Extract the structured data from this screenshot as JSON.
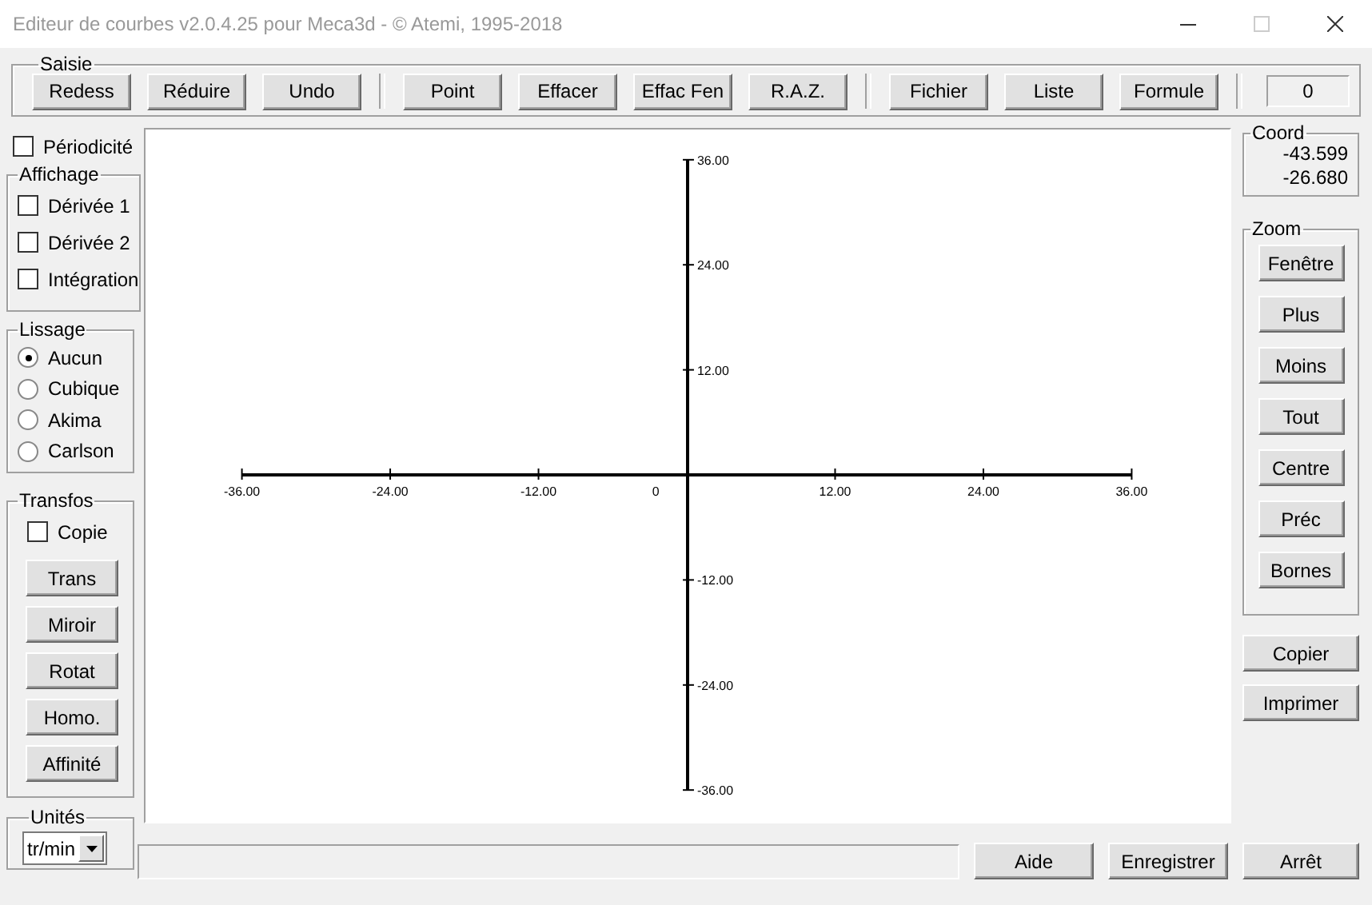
{
  "window": {
    "title": "Editeur de courbes v2.0.4.25 pour Meca3d - © Atemi, 1995-2018",
    "controls": [
      {
        "kind": "minimize",
        "disabled": false
      },
      {
        "kind": "maximize",
        "disabled": true
      },
      {
        "kind": "close",
        "disabled": false
      }
    ]
  },
  "saisie": {
    "label": "Saisie",
    "groups": [
      [
        "Redess",
        "Réduire",
        "Undo"
      ],
      [
        "Point",
        "Effacer",
        "Effac Fen",
        "R.A.Z."
      ],
      [
        "Fichier",
        "Liste",
        "Formule"
      ]
    ],
    "counter": "0"
  },
  "periodicite": {
    "label": "Périodicité",
    "checked": false
  },
  "affichage": {
    "label": "Affichage",
    "options": [
      {
        "label": "Dérivée 1",
        "checked": false
      },
      {
        "label": "Dérivée 2",
        "checked": false
      },
      {
        "label": "Intégration",
        "checked": false
      }
    ]
  },
  "lissage": {
    "label": "Lissage",
    "options": [
      {
        "label": "Aucun",
        "selected": true
      },
      {
        "label": "Cubique",
        "selected": false
      },
      {
        "label": "Akima",
        "selected": false
      },
      {
        "label": "Carlson",
        "selected": false
      }
    ]
  },
  "transfos": {
    "label": "Transfos",
    "copy": {
      "label": "Copie",
      "checked": false
    },
    "buttons": [
      "Trans",
      "Miroir",
      "Rotat",
      "Homo.",
      "Affinité"
    ]
  },
  "unites": {
    "label": "Unités",
    "value": "tr/min"
  },
  "plot": {
    "x_labels": [
      "-36.00",
      "-24.00",
      "-12.00",
      "0",
      "12.00",
      "24.00",
      "36.00"
    ],
    "y_labels": [
      "36.00",
      "24.00",
      "12.00",
      "-12.00",
      "-24.00",
      "-36.00"
    ]
  },
  "coord": {
    "label": "Coord",
    "values": [
      "-43.599",
      "-26.680"
    ]
  },
  "zoom": {
    "label": "Zoom",
    "buttons": [
      "Fenêtre",
      "Plus",
      "Moins",
      "Tout",
      "Centre",
      "Préc",
      "Bornes"
    ]
  },
  "side_buttons": [
    "Copier",
    "Imprimer"
  ],
  "bottom_buttons": [
    "Aide",
    "Enregistrer"
  ],
  "stop_button": "Arrêt"
}
